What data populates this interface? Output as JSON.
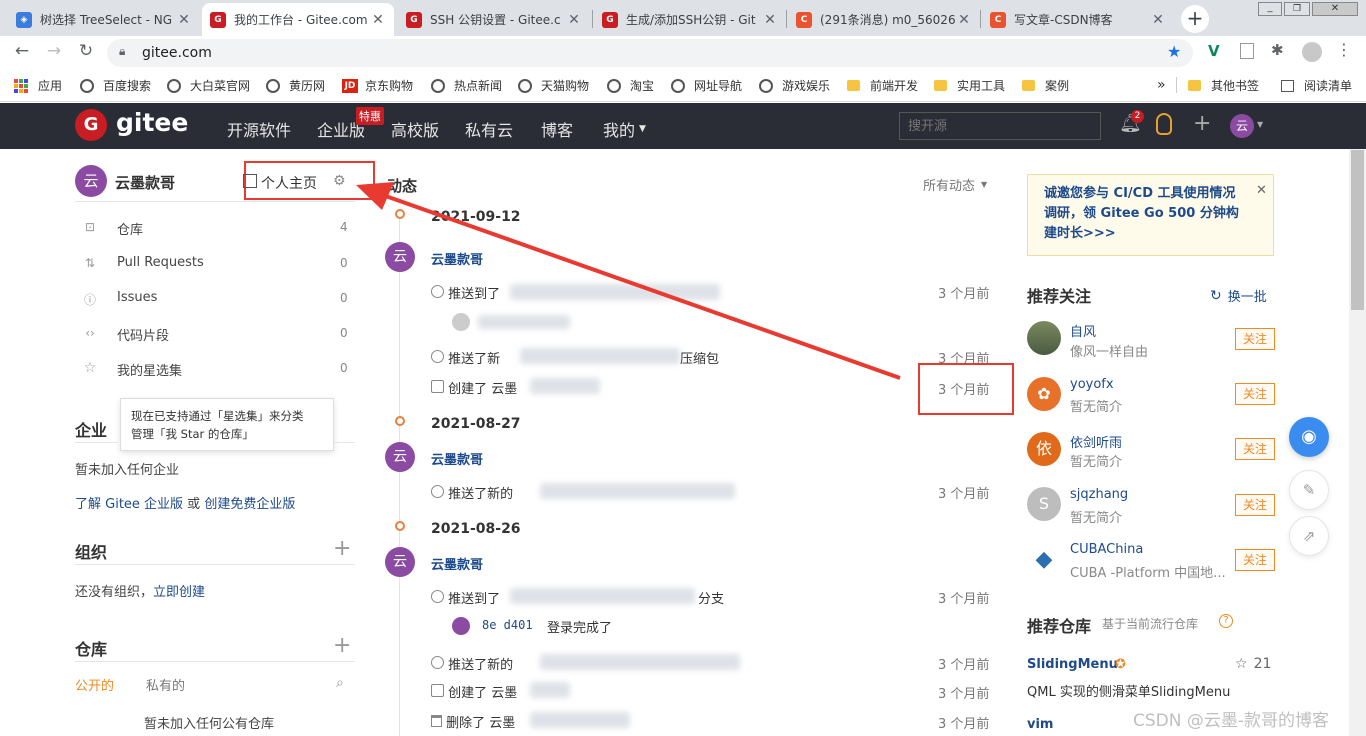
{
  "browser": {
    "tabs": [
      {
        "title": "树选择 TreeSelect - NG",
        "color": "#3b7ddd",
        "glyph": "◈"
      },
      {
        "title": "我的工作台 - Gitee.com",
        "color": "#c71d23",
        "glyph": "G"
      },
      {
        "title": "SSH 公钥设置 - Gitee.c",
        "color": "#c71d23",
        "glyph": "G"
      },
      {
        "title": "生成/添加SSH公钥 - Git",
        "color": "#c71d23",
        "glyph": "G"
      },
      {
        "title": "(291条消息) m0_56026",
        "color": "#e9532f",
        "glyph": "C"
      },
      {
        "title": "写文章-CSDN博客",
        "color": "#e9532f",
        "glyph": "C"
      }
    ],
    "new_tab": "+",
    "url": "gitee.com",
    "bookmarks": [
      {
        "label": "应用",
        "kind": "apps"
      },
      {
        "label": "百度搜索",
        "kind": "globe"
      },
      {
        "label": "大白菜官网",
        "kind": "globe"
      },
      {
        "label": "黄历网",
        "kind": "globe"
      },
      {
        "label": "京东购物",
        "kind": "jd"
      },
      {
        "label": "热点新闻",
        "kind": "globe"
      },
      {
        "label": "天猫购物",
        "kind": "globe"
      },
      {
        "label": "淘宝",
        "kind": "globe"
      },
      {
        "label": "网址导航",
        "kind": "globe"
      },
      {
        "label": "游戏娱乐",
        "kind": "globe"
      },
      {
        "label": "前端开发",
        "kind": "folder"
      },
      {
        "label": "实用工具",
        "kind": "folder"
      },
      {
        "label": "案例",
        "kind": "folder"
      }
    ],
    "bookmarks_more": "»",
    "other_bookmarks": "其他书签",
    "reading_list": "阅读清单"
  },
  "gitee": {
    "logo_text": "gitee",
    "nav": [
      "开源软件",
      "企业版",
      "高校版",
      "私有云",
      "博客",
      "我的"
    ],
    "nav_badge": "特惠",
    "search_placeholder": "搜开源",
    "notif_count": "2",
    "user_avatar_char": "云"
  },
  "sidebar": {
    "user_name": "云墨款哥",
    "avatar_char": "云",
    "home_link": "个人主页",
    "items": [
      {
        "label": "仓库",
        "count": "4",
        "icon": "repo-icon",
        "glyph": "⊡"
      },
      {
        "label": "Pull Requests",
        "count": "0",
        "icon": "pull-request-icon",
        "glyph": "⇅"
      },
      {
        "label": "Issues",
        "count": "0",
        "icon": "issue-icon",
        "glyph": "ⓘ"
      },
      {
        "label": "代码片段",
        "count": "0",
        "icon": "code-icon",
        "glyph": "‹›"
      },
      {
        "label": "我的星选集",
        "count": "0",
        "icon": "star-icon",
        "glyph": "☆"
      }
    ],
    "tooltip_line1": "现在已支持通过「星选集」来分类",
    "tooltip_line2": "管理「我 Star 的仓库」",
    "enterprise_title": "企业",
    "enterprise_none": "暂未加入任何企业",
    "enterprise_learn": "了解 Gitee 企业版",
    "enterprise_or": " 或 ",
    "enterprise_create": "创建免费企业版",
    "org_title": "组织",
    "org_none": "还没有组织，",
    "org_create": "立即创建",
    "repo_title": "仓库",
    "repo_tab_public": "公开的",
    "repo_tab_private": "私有的",
    "repo_none": "暂未加入任何公有仓库"
  },
  "feed": {
    "title": "动态",
    "filter": "所有动态",
    "groups": [
      {
        "date": "2021-09-12",
        "user": "云墨款哥",
        "avatar": "云",
        "events": [
          {
            "text": "推送到了",
            "time": "3 个月前",
            "icon": "push-icon"
          },
          {
            "text": "推送了新",
            "time": "3 个月前",
            "icon": "push-icon"
          },
          {
            "text": "创建了 云墨",
            "time": "3 个月前",
            "icon": "repo-icon"
          }
        ]
      },
      {
        "date": "2021-08-27",
        "user": "云墨款哥",
        "avatar": "云",
        "events": [
          {
            "text": "推送了新的",
            "time": "3 个月前",
            "icon": "push-icon"
          }
        ]
      },
      {
        "date": "2021-08-26",
        "user": "云墨款哥",
        "avatar": "云",
        "events": [
          {
            "text": "推送到了",
            "branch": "分支",
            "time": "3 个月前",
            "icon": "push-icon"
          },
          {
            "text": "推送了新的",
            "time": "3 个月前",
            "icon": "push-icon"
          },
          {
            "text": "创建了 云墨",
            "time": "3 个月前",
            "icon": "repo-icon"
          },
          {
            "text": "删除了 云墨",
            "time": "3 个月前",
            "icon": "delete-icon"
          }
        ]
      }
    ],
    "commit_hash": "8e d401",
    "commit_msg": "登录完成了",
    "partial_text": "压缩包"
  },
  "right": {
    "banner": "诚邀您参与 CI/CD 工具使用情况调研，领 Gitee Go 500 分钟构建时长>>>",
    "rec_title": "推荐关注",
    "refresh": "换一批",
    "follow_label": "关注",
    "users": [
      {
        "name": "自风",
        "desc": "像风一样自由",
        "avatar": "",
        "color": "#6a7b5a"
      },
      {
        "name": "yoyofx",
        "desc": "暂无简介",
        "avatar": "✿",
        "color": "#e8712a"
      },
      {
        "name": "依剑听雨",
        "desc": "暂无简介",
        "avatar": "依",
        "color": "#e06a1a"
      },
      {
        "name": "sjqzhang",
        "desc": "暂无简介",
        "avatar": "S",
        "color": "#bdbdbd"
      },
      {
        "name": "CUBAChina",
        "desc": "CUBA -Platform 中国地...",
        "avatar": "◆",
        "color": "#2a6fb0"
      }
    ],
    "rec_repo_title": "推荐仓库",
    "rec_repo_sub": "基于当前流行仓库",
    "repos": [
      {
        "name": "SlidingMenu",
        "stars": "21",
        "desc": "QML 实现的侧滑菜单SlidingMenu"
      },
      {
        "name": "vim",
        "stars": "",
        "desc": ""
      }
    ]
  },
  "watermark": "CSDN @云墨-款哥的博客",
  "colors": {
    "accent": "#c71d23",
    "arrow": "#e83a30",
    "follow": "#f08a24",
    "link": "#1d4a8a"
  }
}
